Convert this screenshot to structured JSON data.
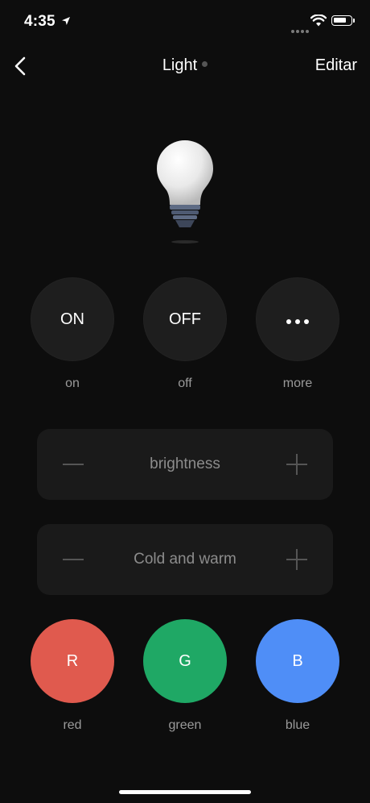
{
  "status_bar": {
    "time": "4:35"
  },
  "nav": {
    "title": "Light",
    "edit_label": "Editar"
  },
  "power_controls": [
    {
      "button": "ON",
      "caption": "on"
    },
    {
      "button": "OFF",
      "caption": "off"
    },
    {
      "button": "",
      "caption": "more"
    }
  ],
  "sliders": [
    {
      "label": "brightness"
    },
    {
      "label": "Cold and warm"
    }
  ],
  "color_controls": [
    {
      "button": "R",
      "caption": "red",
      "color": "#e05a4e"
    },
    {
      "button": "G",
      "caption": "green",
      "color": "#1fa865"
    },
    {
      "button": "B",
      "caption": "blue",
      "color": "#4f8ef7"
    }
  ],
  "icons": {
    "location": "location-arrow-icon",
    "wifi": "wifi-icon",
    "battery": "battery-icon",
    "back": "chevron-left-icon",
    "bulb": "light-bulb-icon",
    "more": "ellipsis-icon"
  }
}
